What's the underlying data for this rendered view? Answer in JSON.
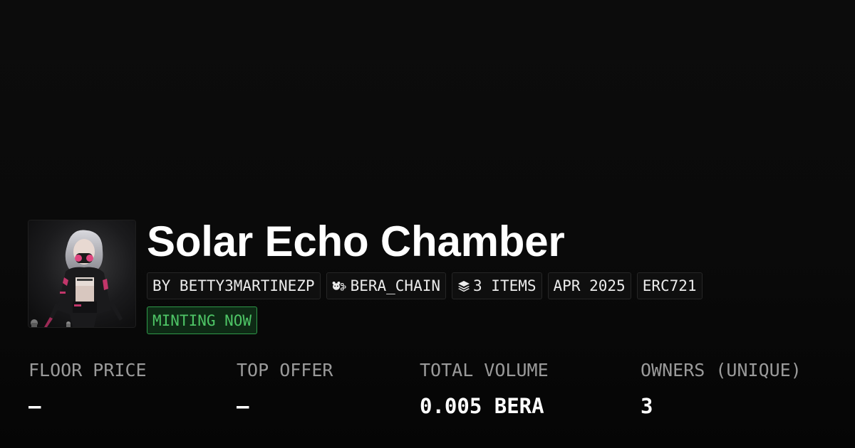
{
  "collection": {
    "title": "Solar Echo Chamber",
    "image_alt": "Collection artwork: silver-haired figure with pink mask and dark jacket",
    "meta_chips": [
      {
        "label": "BY BETTY3MARTINEZP",
        "icon": null
      },
      {
        "label": "BERA_CHAIN",
        "icon": "bear-chain-icon"
      },
      {
        "label": "3 ITEMS",
        "icon": "layers-icon"
      },
      {
        "label": "APR 2025",
        "icon": null
      },
      {
        "label": "ERC721",
        "icon": null
      }
    ],
    "status": "MINTING NOW"
  },
  "stats": [
    {
      "label": "FLOOR PRICE",
      "value": "–"
    },
    {
      "label": "TOP OFFER",
      "value": "–"
    },
    {
      "label": "TOTAL VOLUME",
      "value": "0.005 BERA"
    },
    {
      "label": "OWNERS (UNIQUE)",
      "value": "3"
    }
  ],
  "colors": {
    "background": "#0a0a0a",
    "chip_background": "#0f0f0f",
    "chip_border": "#262626",
    "status_green": "#4ec566",
    "status_bg": "#0e2a15",
    "label_gray": "#9a9a9a",
    "text_white": "#ffffff"
  }
}
